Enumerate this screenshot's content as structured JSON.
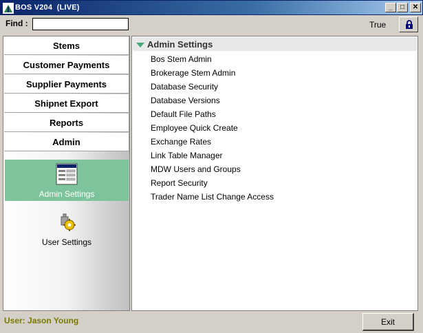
{
  "window": {
    "title": "BOS V204  (LIVE)",
    "buttons": {
      "minimize": "_",
      "maximize": "□",
      "close": "✕"
    },
    "titlebar_color": "#0a246a"
  },
  "find": {
    "label": "Find :",
    "value": "",
    "placeholder": ""
  },
  "status": {
    "value": "True"
  },
  "lock": {
    "icon": "lock-icon"
  },
  "nav": {
    "buttons": [
      {
        "label": "Stems"
      },
      {
        "label": "Customer Payments"
      },
      {
        "label": "Supplier Payments"
      },
      {
        "label": "Shipnet Export"
      },
      {
        "label": "Reports"
      },
      {
        "label": "Admin"
      }
    ],
    "sub_items": [
      {
        "label": "Admin Settings",
        "icon": "admin-settings-icon",
        "selected": true
      },
      {
        "label": "User Settings",
        "icon": "user-settings-icon",
        "selected": false
      }
    ],
    "selected_color": "#7dc49c"
  },
  "content": {
    "section_title": "Admin Settings",
    "links": [
      "Bos Stem Admin",
      "Brokerage Stem Admin",
      "Database Security",
      "Database Versions",
      "Default File Paths",
      "Employee Quick Create",
      "Exchange Rates",
      "Link Table Manager",
      "MDW Users and Groups",
      "Report Security",
      "Trader Name List Change Access"
    ]
  },
  "footer": {
    "user_label": "User: Jason Young",
    "user_color": "#7a7a00",
    "exit_label": "Exit"
  }
}
